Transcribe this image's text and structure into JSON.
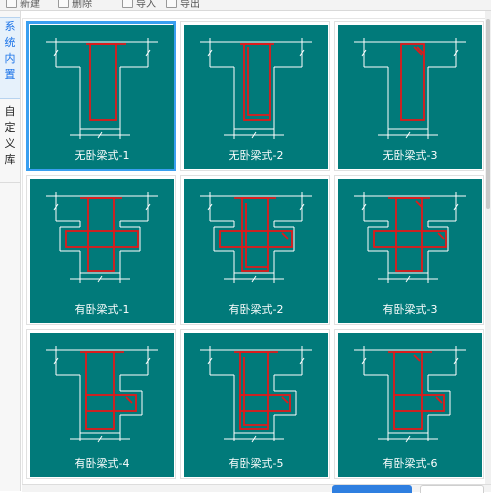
{
  "toolbar": {
    "items": [
      {
        "label": "新建",
        "icon": "new-icon"
      },
      {
        "label": "删除",
        "icon": "delete-icon"
      },
      {
        "label": "导入",
        "icon": "import-icon"
      },
      {
        "label": "导出",
        "icon": "export-icon"
      }
    ]
  },
  "sidebar": {
    "tabs": [
      {
        "label": [
          "系",
          "统",
          "内",
          "置"
        ],
        "active": true
      },
      {
        "label": [
          "自",
          "定",
          "义",
          "库"
        ],
        "active": false
      }
    ]
  },
  "gallery": {
    "items": [
      {
        "caption": "无卧梁式-1",
        "group": "none",
        "variant": 1,
        "selected": true
      },
      {
        "caption": "无卧梁式-2",
        "group": "none",
        "variant": 2,
        "selected": false
      },
      {
        "caption": "无卧梁式-3",
        "group": "none",
        "variant": 3,
        "selected": false
      },
      {
        "caption": "有卧梁式-1",
        "group": "cross",
        "variant": 1,
        "selected": false
      },
      {
        "caption": "有卧梁式-2",
        "group": "cross",
        "variant": 2,
        "selected": false
      },
      {
        "caption": "有卧梁式-3",
        "group": "cross",
        "variant": 3,
        "selected": false
      },
      {
        "caption": "有卧梁式-4",
        "group": "side",
        "variant": 1,
        "selected": false
      },
      {
        "caption": "有卧梁式-5",
        "group": "side",
        "variant": 2,
        "selected": false
      },
      {
        "caption": "有卧梁式-6",
        "group": "side",
        "variant": 3,
        "selected": false
      }
    ]
  },
  "colors": {
    "thumbnail_bg": "#017a7a",
    "outline": "#ffffff",
    "rebar": "#e01a1a",
    "selection": "#3a9ff0",
    "accent": "#2f7fe0"
  }
}
